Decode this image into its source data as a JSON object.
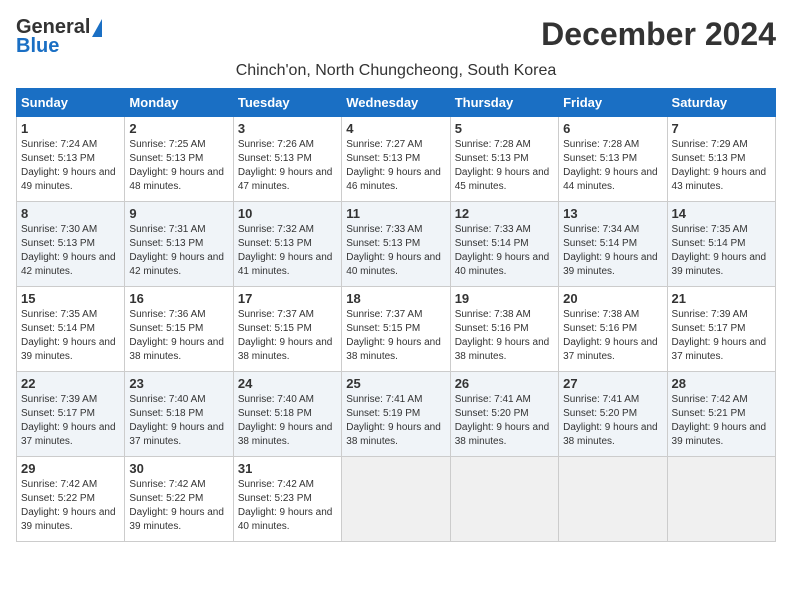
{
  "header": {
    "logo_general": "General",
    "logo_blue": "Blue",
    "month_title": "December 2024",
    "location": "Chinch'on, North Chungcheong, South Korea"
  },
  "weekdays": [
    "Sunday",
    "Monday",
    "Tuesday",
    "Wednesday",
    "Thursday",
    "Friday",
    "Saturday"
  ],
  "weeks": [
    [
      {
        "day": "1",
        "sunrise": "Sunrise: 7:24 AM",
        "sunset": "Sunset: 5:13 PM",
        "daylight": "Daylight: 9 hours and 49 minutes."
      },
      {
        "day": "2",
        "sunrise": "Sunrise: 7:25 AM",
        "sunset": "Sunset: 5:13 PM",
        "daylight": "Daylight: 9 hours and 48 minutes."
      },
      {
        "day": "3",
        "sunrise": "Sunrise: 7:26 AM",
        "sunset": "Sunset: 5:13 PM",
        "daylight": "Daylight: 9 hours and 47 minutes."
      },
      {
        "day": "4",
        "sunrise": "Sunrise: 7:27 AM",
        "sunset": "Sunset: 5:13 PM",
        "daylight": "Daylight: 9 hours and 46 minutes."
      },
      {
        "day": "5",
        "sunrise": "Sunrise: 7:28 AM",
        "sunset": "Sunset: 5:13 PM",
        "daylight": "Daylight: 9 hours and 45 minutes."
      },
      {
        "day": "6",
        "sunrise": "Sunrise: 7:28 AM",
        "sunset": "Sunset: 5:13 PM",
        "daylight": "Daylight: 9 hours and 44 minutes."
      },
      {
        "day": "7",
        "sunrise": "Sunrise: 7:29 AM",
        "sunset": "Sunset: 5:13 PM",
        "daylight": "Daylight: 9 hours and 43 minutes."
      }
    ],
    [
      {
        "day": "8",
        "sunrise": "Sunrise: 7:30 AM",
        "sunset": "Sunset: 5:13 PM",
        "daylight": "Daylight: 9 hours and 42 minutes."
      },
      {
        "day": "9",
        "sunrise": "Sunrise: 7:31 AM",
        "sunset": "Sunset: 5:13 PM",
        "daylight": "Daylight: 9 hours and 42 minutes."
      },
      {
        "day": "10",
        "sunrise": "Sunrise: 7:32 AM",
        "sunset": "Sunset: 5:13 PM",
        "daylight": "Daylight: 9 hours and 41 minutes."
      },
      {
        "day": "11",
        "sunrise": "Sunrise: 7:33 AM",
        "sunset": "Sunset: 5:13 PM",
        "daylight": "Daylight: 9 hours and 40 minutes."
      },
      {
        "day": "12",
        "sunrise": "Sunrise: 7:33 AM",
        "sunset": "Sunset: 5:14 PM",
        "daylight": "Daylight: 9 hours and 40 minutes."
      },
      {
        "day": "13",
        "sunrise": "Sunrise: 7:34 AM",
        "sunset": "Sunset: 5:14 PM",
        "daylight": "Daylight: 9 hours and 39 minutes."
      },
      {
        "day": "14",
        "sunrise": "Sunrise: 7:35 AM",
        "sunset": "Sunset: 5:14 PM",
        "daylight": "Daylight: 9 hours and 39 minutes."
      }
    ],
    [
      {
        "day": "15",
        "sunrise": "Sunrise: 7:35 AM",
        "sunset": "Sunset: 5:14 PM",
        "daylight": "Daylight: 9 hours and 39 minutes."
      },
      {
        "day": "16",
        "sunrise": "Sunrise: 7:36 AM",
        "sunset": "Sunset: 5:15 PM",
        "daylight": "Daylight: 9 hours and 38 minutes."
      },
      {
        "day": "17",
        "sunrise": "Sunrise: 7:37 AM",
        "sunset": "Sunset: 5:15 PM",
        "daylight": "Daylight: 9 hours and 38 minutes."
      },
      {
        "day": "18",
        "sunrise": "Sunrise: 7:37 AM",
        "sunset": "Sunset: 5:15 PM",
        "daylight": "Daylight: 9 hours and 38 minutes."
      },
      {
        "day": "19",
        "sunrise": "Sunrise: 7:38 AM",
        "sunset": "Sunset: 5:16 PM",
        "daylight": "Daylight: 9 hours and 38 minutes."
      },
      {
        "day": "20",
        "sunrise": "Sunrise: 7:38 AM",
        "sunset": "Sunset: 5:16 PM",
        "daylight": "Daylight: 9 hours and 37 minutes."
      },
      {
        "day": "21",
        "sunrise": "Sunrise: 7:39 AM",
        "sunset": "Sunset: 5:17 PM",
        "daylight": "Daylight: 9 hours and 37 minutes."
      }
    ],
    [
      {
        "day": "22",
        "sunrise": "Sunrise: 7:39 AM",
        "sunset": "Sunset: 5:17 PM",
        "daylight": "Daylight: 9 hours and 37 minutes."
      },
      {
        "day": "23",
        "sunrise": "Sunrise: 7:40 AM",
        "sunset": "Sunset: 5:18 PM",
        "daylight": "Daylight: 9 hours and 37 minutes."
      },
      {
        "day": "24",
        "sunrise": "Sunrise: 7:40 AM",
        "sunset": "Sunset: 5:18 PM",
        "daylight": "Daylight: 9 hours and 38 minutes."
      },
      {
        "day": "25",
        "sunrise": "Sunrise: 7:41 AM",
        "sunset": "Sunset: 5:19 PM",
        "daylight": "Daylight: 9 hours and 38 minutes."
      },
      {
        "day": "26",
        "sunrise": "Sunrise: 7:41 AM",
        "sunset": "Sunset: 5:20 PM",
        "daylight": "Daylight: 9 hours and 38 minutes."
      },
      {
        "day": "27",
        "sunrise": "Sunrise: 7:41 AM",
        "sunset": "Sunset: 5:20 PM",
        "daylight": "Daylight: 9 hours and 38 minutes."
      },
      {
        "day": "28",
        "sunrise": "Sunrise: 7:42 AM",
        "sunset": "Sunset: 5:21 PM",
        "daylight": "Daylight: 9 hours and 39 minutes."
      }
    ],
    [
      {
        "day": "29",
        "sunrise": "Sunrise: 7:42 AM",
        "sunset": "Sunset: 5:22 PM",
        "daylight": "Daylight: 9 hours and 39 minutes."
      },
      {
        "day": "30",
        "sunrise": "Sunrise: 7:42 AM",
        "sunset": "Sunset: 5:22 PM",
        "daylight": "Daylight: 9 hours and 39 minutes."
      },
      {
        "day": "31",
        "sunrise": "Sunrise: 7:42 AM",
        "sunset": "Sunset: 5:23 PM",
        "daylight": "Daylight: 9 hours and 40 minutes."
      },
      null,
      null,
      null,
      null
    ]
  ]
}
